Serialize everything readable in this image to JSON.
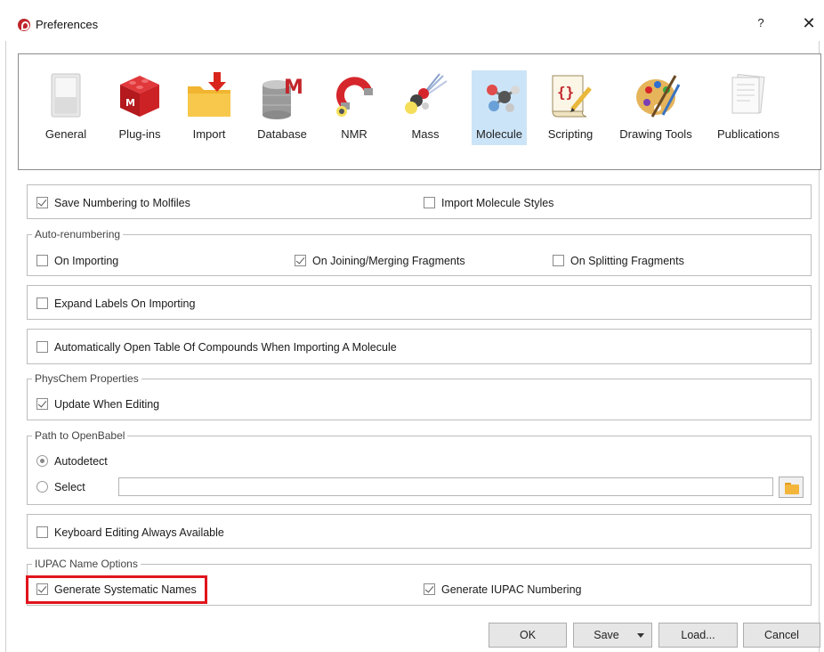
{
  "window": {
    "title": "Preferences",
    "help_label": "?",
    "close_label": "✕"
  },
  "toolbar": {
    "items": [
      {
        "label": "General",
        "icon": "switch-icon"
      },
      {
        "label": "Plug-ins",
        "icon": "plugin-cube-icon"
      },
      {
        "label": "Import",
        "icon": "import-folder-icon"
      },
      {
        "label": "Database",
        "icon": "database-icon"
      },
      {
        "label": "NMR",
        "icon": "nmr-magnet-icon"
      },
      {
        "label": "Mass",
        "icon": "mass-spec-icon"
      },
      {
        "label": "Molecule",
        "icon": "molecule-icon",
        "selected": true
      },
      {
        "label": "Scripting",
        "icon": "script-scroll-icon"
      },
      {
        "label": "Drawing Tools",
        "icon": "palette-icon"
      },
      {
        "label": "Publications",
        "icon": "document-icon"
      }
    ]
  },
  "options": {
    "save_numbering": {
      "label": "Save Numbering to Molfiles",
      "checked": true
    },
    "import_styles": {
      "label": "Import Molecule Styles",
      "checked": false
    }
  },
  "auto_renumbering": {
    "legend": "Auto-renumbering",
    "on_importing": {
      "label": "On Importing",
      "checked": false
    },
    "on_joining": {
      "label": "On Joining/Merging Fragments",
      "checked": true
    },
    "on_splitting": {
      "label": "On Splitting Fragments",
      "checked": false
    }
  },
  "expand_labels": {
    "label": "Expand Labels On Importing",
    "checked": false
  },
  "auto_open_table": {
    "label": "Automatically Open Table Of Compounds When Importing A Molecule",
    "checked": false
  },
  "physchem": {
    "legend": "PhysChem Properties",
    "update_when_editing": {
      "label": "Update When Editing",
      "checked": true
    }
  },
  "openbabel": {
    "legend": "Path to OpenBabel",
    "autodetect": {
      "label": "Autodetect",
      "selected": true
    },
    "select": {
      "label": "Select",
      "selected": false
    },
    "path_value": ""
  },
  "keyboard_editing": {
    "label": "Keyboard Editing Always Available",
    "checked": false
  },
  "iupac": {
    "legend": "IUPAC Name Options",
    "systematic_names": {
      "label": "Generate Systematic Names",
      "checked": true
    },
    "iupac_numbering": {
      "label": "Generate IUPAC Numbering",
      "checked": true
    }
  },
  "buttons": {
    "ok": "OK",
    "save": "Save",
    "load": "Load...",
    "cancel": "Cancel"
  },
  "colors": {
    "selected_tab": "#cce4f7",
    "highlight": "#e1141c",
    "app_icon": "#c0262c"
  }
}
